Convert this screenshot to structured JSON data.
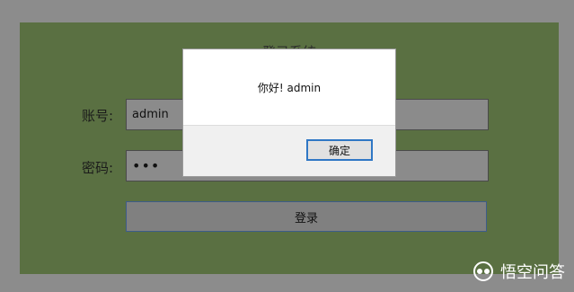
{
  "login_form": {
    "title": "登录系统",
    "account_label": "账号:",
    "account_value": "admin",
    "password_label": "密码:",
    "password_value": "•••",
    "login_button": "登录"
  },
  "alert_dialog": {
    "message": "你好! admin",
    "ok_button": "确定"
  },
  "watermark": {
    "text": "悟空问答"
  }
}
